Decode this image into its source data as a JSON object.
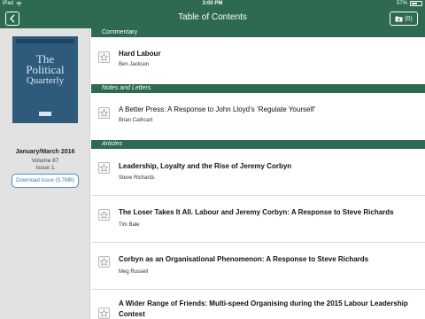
{
  "status_bar": {
    "device": "iPad",
    "time": "3:00 PM",
    "battery": "57%",
    "battery_level": 0.57
  },
  "nav": {
    "title": "Table of Contents",
    "library_count": "(0)"
  },
  "issue": {
    "cover_text_1": "The",
    "cover_text_2": "Political",
    "cover_text_3": "Quarterly",
    "date": "January/March 2016",
    "volume": "Volume 87",
    "number": "Issue 1",
    "download_label": "Download Issue (3.7MB)"
  },
  "sections": [
    {
      "name": "Commentary",
      "articles": [
        {
          "title": "Hard Labour",
          "author": "Ben Jackson"
        }
      ]
    },
    {
      "name": "Notes and Letters",
      "articles": [
        {
          "title": "A Better Press: A Response to John Lloyd’s ‘Regulate Yourself’",
          "author": "Brian Cathcart"
        }
      ]
    },
    {
      "name": "Articles",
      "articles": [
        {
          "title": "Leadership, Loyalty and the Rise of Jeremy Corbyn",
          "author": "Steve Richards"
        },
        {
          "title": "The Loser Takes It All. Labour and Jeremy Corbyn: A Response to Steve Richards",
          "author": "Tim Bale"
        },
        {
          "title": "Corbyn as an Organisational Phenomenon: A Response to Steve Richards",
          "author": "Meg Russell"
        },
        {
          "title": "A Wider Range of Friends: Multi-speed Organising during the 2015 Labour Leadership Contest",
          "author": ""
        }
      ]
    }
  ],
  "colors": {
    "header": "#2d6a4f",
    "sidebar": "#e2e2e2",
    "link": "#3b7bbf"
  },
  "icons": {
    "back": "chevron-left-icon",
    "library": "download-folder-icon",
    "favorite": "star-icon",
    "wifi": "wifi-icon",
    "battery": "battery-icon"
  }
}
